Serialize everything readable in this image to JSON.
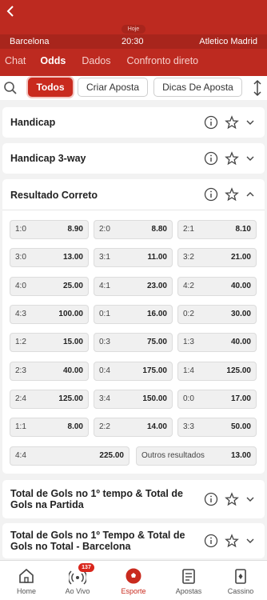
{
  "header": {
    "back_icon": "chevron-left-icon",
    "day_label": "Hoje",
    "home_team": "Barcelona",
    "match_time": "20:30",
    "away_team": "Atletico Madrid",
    "tabs": [
      {
        "label": "Chat",
        "active": false
      },
      {
        "label": "Odds",
        "active": true
      },
      {
        "label": "Dados",
        "active": false
      },
      {
        "label": "Confronto direto",
        "active": false
      }
    ]
  },
  "filters": {
    "chips": [
      {
        "label": "Todos",
        "active": true
      },
      {
        "label": "Criar Aposta",
        "active": false
      },
      {
        "label": "Dicas De Aposta",
        "active": false
      }
    ]
  },
  "markets": {
    "handicap": "Handicap",
    "handicap_3way": "Handicap 3-way",
    "correct_score": "Resultado Correto",
    "goals_first_half_total": "Total de Gols no 1º tempo & Total de Gols na Partida",
    "goals_first_half_barcelona": "Total de Gols no 1º Tempo & Total de Gols no Total - Barcelona"
  },
  "correct_score_odds": [
    {
      "label": "1:0",
      "value": "8.90"
    },
    {
      "label": "2:0",
      "value": "8.80"
    },
    {
      "label": "2:1",
      "value": "8.10"
    },
    {
      "label": "3:0",
      "value": "13.00"
    },
    {
      "label": "3:1",
      "value": "11.00"
    },
    {
      "label": "3:2",
      "value": "21.00"
    },
    {
      "label": "4:0",
      "value": "25.00"
    },
    {
      "label": "4:1",
      "value": "23.00"
    },
    {
      "label": "4:2",
      "value": "40.00"
    },
    {
      "label": "4:3",
      "value": "100.00"
    },
    {
      "label": "0:1",
      "value": "16.00"
    },
    {
      "label": "0:2",
      "value": "30.00"
    },
    {
      "label": "1:2",
      "value": "15.00"
    },
    {
      "label": "0:3",
      "value": "75.00"
    },
    {
      "label": "1:3",
      "value": "40.00"
    },
    {
      "label": "2:3",
      "value": "40.00"
    },
    {
      "label": "0:4",
      "value": "175.00"
    },
    {
      "label": "1:4",
      "value": "125.00"
    },
    {
      "label": "2:4",
      "value": "125.00"
    },
    {
      "label": "3:4",
      "value": "150.00"
    },
    {
      "label": "0:0",
      "value": "17.00"
    },
    {
      "label": "1:1",
      "value": "8.00"
    },
    {
      "label": "2:2",
      "value": "14.00"
    },
    {
      "label": "3:3",
      "value": "50.00"
    }
  ],
  "correct_score_extra": [
    {
      "label": "4:4",
      "value": "225.00"
    },
    {
      "label": "Outros resultados",
      "value": "13.00"
    }
  ],
  "bottom_nav": {
    "items": [
      {
        "label": "Home",
        "icon": "home-icon"
      },
      {
        "label": "Ao Vivo",
        "icon": "live-signal-icon",
        "badge": "137"
      },
      {
        "label": "Esporte",
        "icon": "soccer-ball-icon",
        "active": true
      },
      {
        "label": "Apostas",
        "icon": "bet-slip-icon"
      },
      {
        "label": "Cassino",
        "icon": "casino-card-icon"
      }
    ]
  },
  "colors": {
    "brand": "#bd2a20",
    "accent": "#c92a1e"
  }
}
